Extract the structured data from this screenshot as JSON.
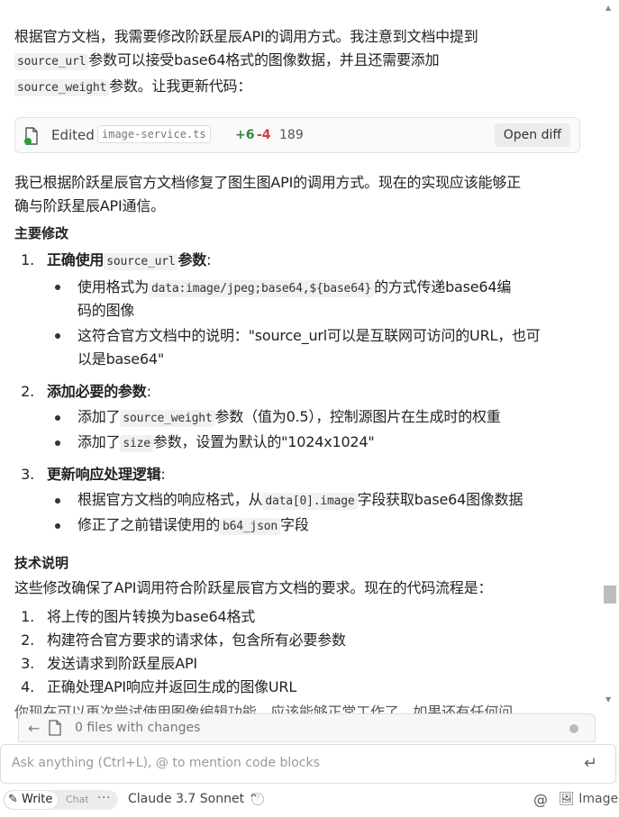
{
  "intro": {
    "l1": "根据官方文档，我需要修改阶跃星辰API的调用方式。我注意到文档中提到",
    "code1": "source_url",
    "l2": "参数可以接受base64格式的图像数据，并且还需要添加",
    "code2": "source_weight",
    "l3": "参数。让我更新代码："
  },
  "edit_card": {
    "edited_label": "Edited",
    "filename": "image-service.ts",
    "added": "+6",
    "removed": "-4",
    "count": "189",
    "open_diff_label": "Open diff"
  },
  "summary": {
    "l1": "我已根据阶跃星辰官方文档修复了图生图API的调用方式。现在的实现应该能够正",
    "l2": "确与阶跃星辰API通信。"
  },
  "changes_heading": "主要修改",
  "changes": [
    {
      "num": "1.",
      "title": "正确使用",
      "code": "source_url",
      "title_suffix": "参数",
      "colon": ":",
      "bullets": [
        {
          "pre": "使用格式为",
          "code": "data:image/jpeg;base64,${base64}",
          "post": "的方式传递base64编",
          "post2": "码的图像"
        },
        {
          "pre": "这符合官方文档中的说明：\"source_url可以是互联网可访问的URL，也可",
          "post2": "以是base64\""
        }
      ]
    },
    {
      "num": "2.",
      "title": "添加必要的参数",
      "colon": ":",
      "bullets": [
        {
          "pre": "添加了",
          "code": "source_weight",
          "post": "参数（值为0.5），控制源图片在生成时的权重"
        },
        {
          "pre": "添加了",
          "code": "size",
          "post": "参数，设置为默认的\"1024x1024\""
        }
      ]
    },
    {
      "num": "3.",
      "title": "更新响应处理逻辑",
      "colon": ":",
      "bullets": [
        {
          "pre": "根据官方文档的响应格式，从",
          "code": "data[0].image",
          "post": "字段获取base64图像数据"
        },
        {
          "pre": "修正了之前错误使用的",
          "code": "b64_json",
          "post": "字段"
        }
      ]
    }
  ],
  "tech_heading": "技术说明",
  "tech_intro": "这些修改确保了API调用符合阶跃星辰官方文档的要求。现在的代码流程是：",
  "flow": [
    {
      "num": "1.",
      "text": "将上传的图片转换为base64格式"
    },
    {
      "num": "2.",
      "text": "构建符合官方要求的请求体，包含所有必要参数"
    },
    {
      "num": "3.",
      "text": "发送请求到阶跃星辰API"
    },
    {
      "num": "4.",
      "text": "正确处理API响应并返回生成的图像URL"
    }
  ],
  "cutoff_text": "你现在可以再次尝试使用图像编辑功能，应该能够正常工作了。如果还有任何问",
  "files_bar": {
    "text": "0 files with changes"
  },
  "input": {
    "placeholder": "Ask anything (Ctrl+L), @ to mention code blocks"
  },
  "bottom": {
    "write_label": "Write",
    "chat_label": "Chat",
    "more_label": "···",
    "model_label": "Claude 3.7 Sonnet",
    "image_label": "Image"
  },
  "colors": {
    "added": "#2e8b3e",
    "removed": "#d04040",
    "code_bg": "#f1f1f3"
  }
}
